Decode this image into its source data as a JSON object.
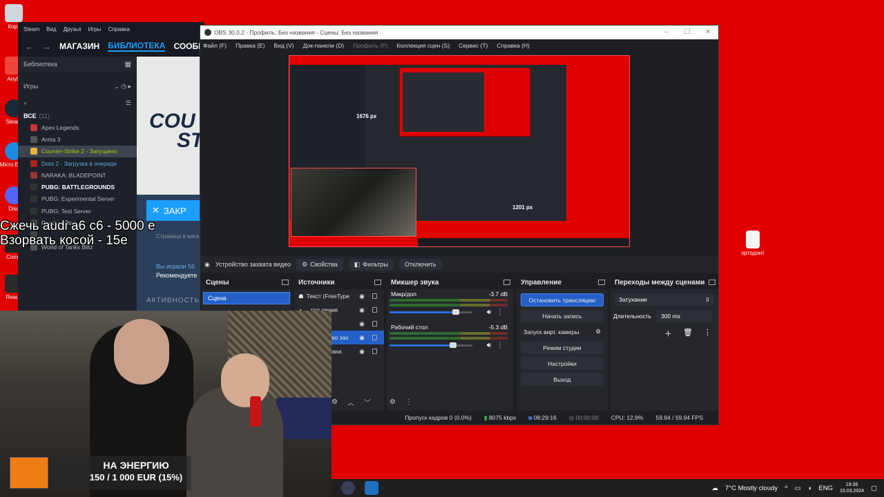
{
  "desktop": {
    "icons": [
      {
        "label": "Корз"
      },
      {
        "label": "AnyD"
      },
      {
        "label": "Steam"
      },
      {
        "label": "Micro Edge"
      },
      {
        "label": "Disc"
      },
      {
        "label": "Corne"
      },
      {
        "label": "Ready"
      }
    ],
    "file_icon_label": "ортодонт"
  },
  "steam": {
    "menu": [
      "Steam",
      "Вид",
      "Друзья",
      "Игры",
      "Справка"
    ],
    "nav": {
      "store": "МАГАЗИН",
      "library": "БИБЛИОТЕКА",
      "community": "СООБЩ"
    },
    "library_label": "Библиотека",
    "filter_label": "Игры",
    "all_label": "ВСЕ",
    "all_count": "(11)",
    "games": [
      {
        "name": "Apex Legends",
        "state": ""
      },
      {
        "name": "Arma 3",
        "state": ""
      },
      {
        "name": "Counter-Strike 2 - Запущено",
        "state": "running"
      },
      {
        "name": "Dota 2 - Загрузка в очереди",
        "state": "queued"
      },
      {
        "name": "NARAKA: BLADEPOINT",
        "state": ""
      },
      {
        "name": "PUBG: BATTLEGROUNDS",
        "state": "bold"
      },
      {
        "name": "PUBG: Experimental Server",
        "state": ""
      },
      {
        "name": "PUBG: Test Server",
        "state": ""
      },
      {
        "name": "Ready or Not",
        "state": ""
      },
      {
        "name": "",
        "state": ""
      },
      {
        "name": "World of Tanks Blitz",
        "state": ""
      }
    ],
    "banner_line1": "COU",
    "banner_line2": "ST",
    "close_button": "ЗАКР",
    "store_page": "Страница в мага",
    "played_line1": "Вы играли 56",
    "played_line2": "Рекомендуете",
    "activity": "АКТИВНОСТЬ"
  },
  "overlay": {
    "line1": "Сжечь audi a6 c6 - 5000 е",
    "line2": "Взорвать косой - 15е"
  },
  "obs": {
    "title": "OBS 30.0.2 - Профиль: Без названия - Сцены: Без названия",
    "menu": {
      "file": "Файл (F)",
      "edit": "Правка (E)",
      "view": "Вид (V)",
      "docks": "Док-панели (D)",
      "profile": "Профиль (P)",
      "scene_collection": "Коллекция сцен (S)",
      "tools": "Сервис (T)",
      "help": "Справка (H)"
    },
    "preview_labels": {
      "width": "1201 px",
      "height": "1676 px"
    },
    "source_bar": {
      "source": "Устройство захвата видео",
      "properties": "Свойства",
      "filters": "Фильтры",
      "deactivate": "Отключить"
    },
    "scenes": {
      "title": "Сцены",
      "items": [
        "Сцена"
      ]
    },
    "sources": {
      "title": "Источники",
      "items": [
        {
          "name": "Текст (FreeType",
          "selected": false
        },
        {
          "name": "…тол ления",
          "selected": false
        },
        {
          "name": "",
          "selected": false
        },
        {
          "name": "ство зах",
          "selected": true
        },
        {
          "name": "крана",
          "selected": false
        }
      ]
    },
    "mixer": {
      "title": "Микшер звука",
      "channels": [
        {
          "name": "Микр/доп",
          "db": "-3.7 dB",
          "level": 0.8
        },
        {
          "name": "Рабочий стол",
          "db": "-5.3 dB",
          "level": 0.77
        }
      ],
      "scale": [
        "-60",
        "-55",
        "-50",
        "-45",
        "-40",
        "-35",
        "-30",
        "-25",
        "-20",
        "-15",
        "-10",
        "-5",
        "0"
      ]
    },
    "controls": {
      "title": "Управление",
      "stop_stream": "Остановить трансляцию",
      "start_record": "Начать запись",
      "virtual_cam": "Запуск вирт. камеры",
      "studio_mode": "Режим студии",
      "settings": "Настройки",
      "exit": "Выход"
    },
    "transitions": {
      "title": "Переходы между сценами",
      "type": "Затухание",
      "duration_label": "Длительность",
      "duration": "300 ms"
    },
    "status": {
      "dropped": "Пропуск кадров 0 (0.0%)",
      "bitrate": "8075 kbps",
      "stream_time": "08:29:16",
      "rec_time": "00:00:00",
      "cpu": "CPU: 12.9%",
      "fps": "59.94 / 59.94 FPS"
    }
  },
  "donation": {
    "title": "НА ЭНЕРГИЮ",
    "progress": "150 / 1 000 EUR (15%)",
    "fraction": 0.15
  },
  "taskbar": {
    "weather": "7°C  Mostly cloudy",
    "lang": "ENG",
    "time": "19:36",
    "date": "15.03.2024"
  }
}
